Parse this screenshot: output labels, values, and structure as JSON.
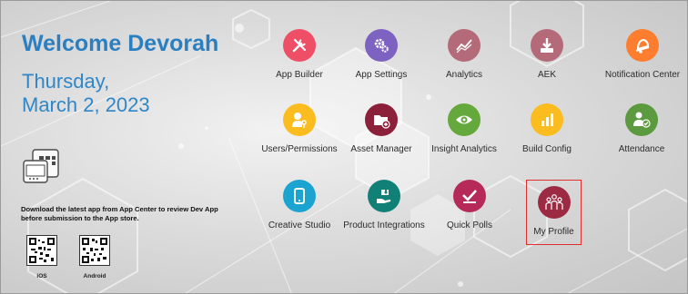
{
  "header": {
    "welcome": "Welcome Devorah",
    "day": "Thursday,",
    "date": "March 2, 2023"
  },
  "download": {
    "text": "Download the latest app from App Center to review Dev App before submission to the App store.",
    "ios_label": "iOS",
    "android_label": "Android"
  },
  "apps": [
    {
      "label": "App Builder",
      "color": "#ee4e66",
      "icon": "tools-icon"
    },
    {
      "label": "App Settings",
      "color": "#7d62c2",
      "icon": "gears-icon"
    },
    {
      "label": "Analytics",
      "color": "#b56a79",
      "icon": "chart-line-icon"
    },
    {
      "label": "AEK",
      "color": "#b56a79",
      "icon": "download-icon"
    },
    {
      "label": "Notification Center",
      "color": "#ff7d2e",
      "icon": "bell-icon"
    },
    {
      "label": "Users/Permissions",
      "color": "#fbbc20",
      "icon": "user-key-icon"
    },
    {
      "label": "Asset Manager",
      "color": "#8c1f3a",
      "icon": "folder-add-icon"
    },
    {
      "label": "Insight Analytics",
      "color": "#65a83c",
      "icon": "eye-icon"
    },
    {
      "label": "Build Config",
      "color": "#fbbc20",
      "icon": "bar-chart-icon"
    },
    {
      "label": "Attendance",
      "color": "#5b9a3e",
      "icon": "user-check-icon"
    },
    {
      "label": "Creative Studio",
      "color": "#1ba4cf",
      "icon": "tablet-icon"
    },
    {
      "label": "Product Integrations",
      "color": "#118178",
      "icon": "hand-puzzle-icon"
    },
    {
      "label": "Quick Polls",
      "color": "#b52a58",
      "icon": "poll-check-icon"
    },
    {
      "label": "My Profile",
      "color": "#9d2a43",
      "icon": "group-icon"
    }
  ]
}
